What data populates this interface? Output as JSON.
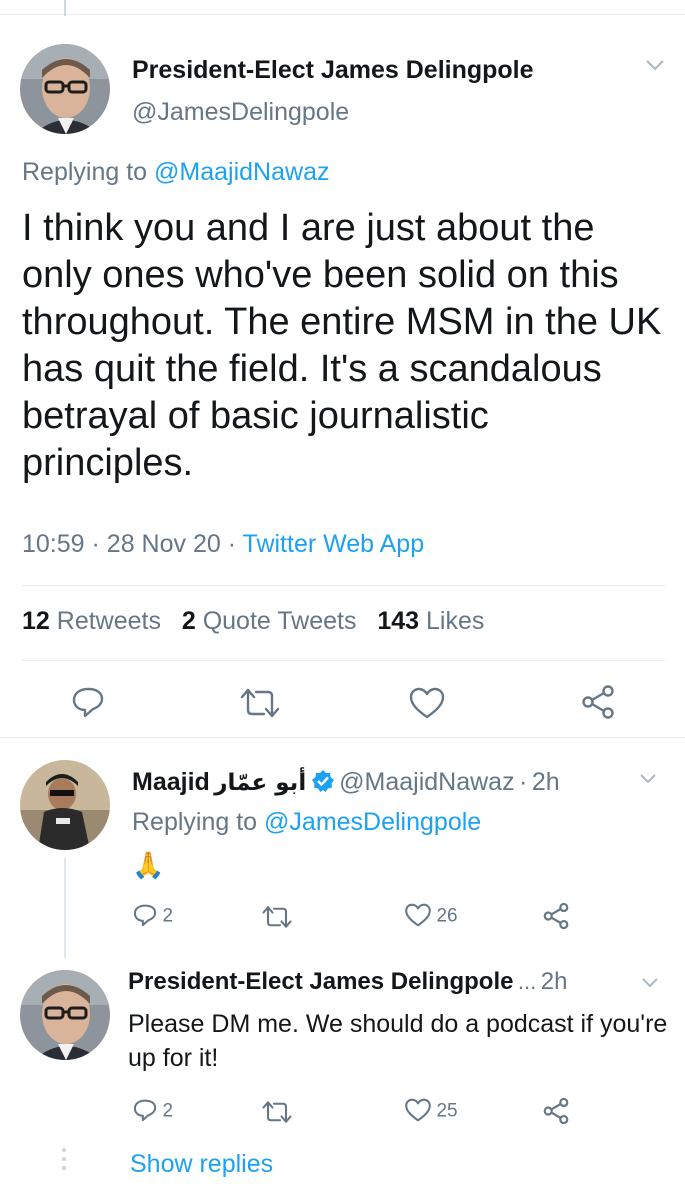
{
  "main_tweet": {
    "display_name": "President-Elect James Delingpole",
    "handle": "@JamesDelingpole",
    "replying_prefix": "Replying to",
    "replying_to": "@MaajidNawaz",
    "text": "I think you and I are just about the only ones who've been solid on this throughout. The entire MSM in the UK has quit the field. It's a scandalous betrayal of basic journalistic principles.",
    "time": "10:59",
    "date": "28 Nov 20",
    "source": "Twitter Web App",
    "retweets_count": "12",
    "retweets_label": "Retweets",
    "quotes_count": "2",
    "quotes_label": "Quote Tweets",
    "likes_count": "143",
    "likes_label": "Likes"
  },
  "reply1": {
    "name_latin": "Maajid",
    "name_arabic": "أبو عمّار",
    "handle": "@MaajidNawaz",
    "time": "2h",
    "replying_prefix": "Replying to",
    "replying_to": "@JamesDelingpole",
    "emoji": "🙏",
    "reply_count": "2",
    "like_count": "26"
  },
  "reply2": {
    "display_name": "President-Elect James Delingpole",
    "ellipsis": "...",
    "time": "2h",
    "text": "Please DM me. We should do a podcast if you're up for it!",
    "reply_count": "2",
    "like_count": "25"
  },
  "show_replies": "Show replies",
  "separator": "·",
  "colors": {
    "link": "#1da1f2",
    "muted": "#657786",
    "verified": "#1da1f2"
  },
  "icons": [
    "chevron-down-icon",
    "reply-icon",
    "retweet-icon",
    "like-icon",
    "share-icon",
    "verified-badge-icon"
  ]
}
